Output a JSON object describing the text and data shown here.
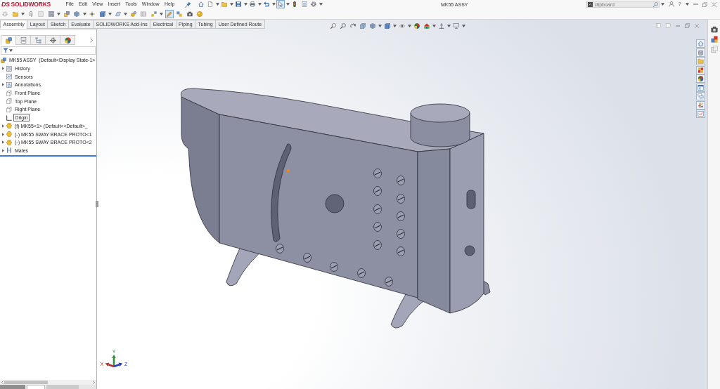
{
  "app": {
    "logo_mark": "DS",
    "logo_name": "SOLIDWORKS",
    "menu": [
      "File",
      "Edit",
      "View",
      "Insert",
      "Tools",
      "Window",
      "Help"
    ],
    "title": "MK55 ASSY",
    "search": {
      "value": "clipboard"
    },
    "help": "?"
  },
  "quick_access": [
    {
      "on": false
    },
    {
      "on": false
    },
    {
      "on": false
    },
    {
      "on": false
    },
    {
      "on": false
    },
    {
      "on": false
    },
    {
      "on": true
    },
    {
      "on": false
    },
    {
      "on": false
    },
    {
      "on": false
    }
  ],
  "command_toolbar": [
    {
      "on": false
    },
    {
      "on": false
    },
    {
      "on": false
    },
    {
      "on": false
    },
    {
      "on": false
    },
    {
      "on": false
    },
    {
      "on": false
    },
    {
      "on": false
    },
    {
      "on": false
    },
    {
      "on": false
    },
    {
      "on": false
    },
    {
      "on": false
    },
    {
      "on": false
    },
    {
      "on": true
    },
    {
      "on": false
    },
    {
      "on": false
    },
    {
      "on": false
    }
  ],
  "command_tabs": [
    {
      "label": "Assembly",
      "selected": true
    },
    {
      "label": "Layout",
      "selected": false
    },
    {
      "label": "Sketch",
      "selected": false
    },
    {
      "label": "Evaluate",
      "selected": false
    },
    {
      "label": "SOLIDWORKS Add-Ins",
      "selected": false
    },
    {
      "label": "Electrical",
      "selected": false
    },
    {
      "label": "Piping",
      "selected": false
    },
    {
      "label": "Tubing",
      "selected": false
    },
    {
      "label": "User Defined Route",
      "selected": false
    }
  ],
  "feature_manager": {
    "tabs": [
      {
        "selected": true
      },
      {
        "selected": false
      },
      {
        "selected": false
      },
      {
        "selected": false
      },
      {
        "selected": false
      }
    ],
    "tree": [
      {
        "kind": "assembly",
        "label": "MK55 ASSY  (Default<Display State-1>",
        "collapsed": false,
        "selected": false,
        "children": [
          {
            "kind": "history",
            "label": "History",
            "collapsed": true,
            "selected": false
          },
          {
            "kind": "sensors",
            "label": "Sensors",
            "collapsed": false,
            "selected": false
          },
          {
            "kind": "annotations",
            "label": "Annotations",
            "collapsed": true,
            "selected": false
          },
          {
            "kind": "plane",
            "label": "Front Plane",
            "collapsed": false,
            "selected": false
          },
          {
            "kind": "plane",
            "label": "Top Plane",
            "collapsed": false,
            "selected": false
          },
          {
            "kind": "plane",
            "label": "Right Plane",
            "collapsed": false,
            "selected": false
          },
          {
            "kind": "origin",
            "label": "Origin",
            "collapsed": false,
            "selected": true
          },
          {
            "kind": "part",
            "label": "(f) MK55<1> (Default<<Default>_",
            "collapsed": true,
            "selected": false
          },
          {
            "kind": "part",
            "label": "(-) MK55 SWAY BRACE PROTO<1",
            "collapsed": true,
            "selected": false
          },
          {
            "kind": "part",
            "label": "(-) MK55 SWAY BRACE PROTO<2",
            "collapsed": true,
            "selected": false
          },
          {
            "kind": "mates",
            "label": "Mates",
            "collapsed": true,
            "selected": false
          }
        ]
      }
    ]
  },
  "triad": [
    {
      "label": "Y",
      "color": "#2f8f3a"
    },
    {
      "label": "X",
      "color": "#b3302c"
    },
    {
      "label": "Z",
      "color": "#2b3db8"
    }
  ]
}
